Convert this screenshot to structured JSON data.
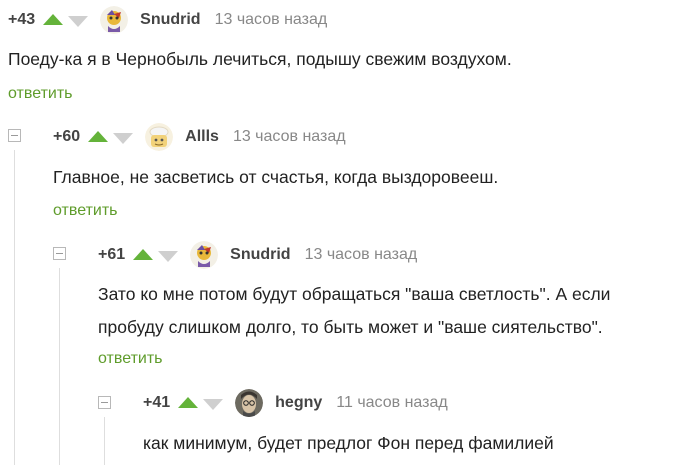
{
  "comments": [
    {
      "rating": "+43",
      "author": "Snudrid",
      "time": "13 часов назад",
      "lines": [
        "Поеду-ка я в Чернобыль лечиться, подышу свежим воздухом."
      ],
      "reply": "ответить"
    },
    {
      "rating": "+60",
      "author": "Allls",
      "time": "13 часов назад",
      "lines": [
        "Главное, не засветись от счастья, когда выздоровееш."
      ],
      "reply": "ответить"
    },
    {
      "rating": "+61",
      "author": "Snudrid",
      "time": "13 часов назад",
      "lines": [
        "Зато ко мне потом будут обращаться \"ваша светлость\". А если",
        "пробуду слишком долго, то быть может и \"ваше сиятельство\"."
      ],
      "reply": "ответить"
    },
    {
      "rating": "+41",
      "author": "hegny",
      "time": "11 часов назад",
      "lines": [
        "как минимум, будет предлог Фон перед фамилией"
      ]
    }
  ],
  "colors": {
    "vote_up": "#64b33a",
    "vote_down": "#cfcfcf",
    "reply_link": "#5f9c2b",
    "time": "#888888"
  },
  "icons": [
    "collapse-thread-icon",
    "upvote-icon",
    "downvote-icon",
    "avatar"
  ]
}
